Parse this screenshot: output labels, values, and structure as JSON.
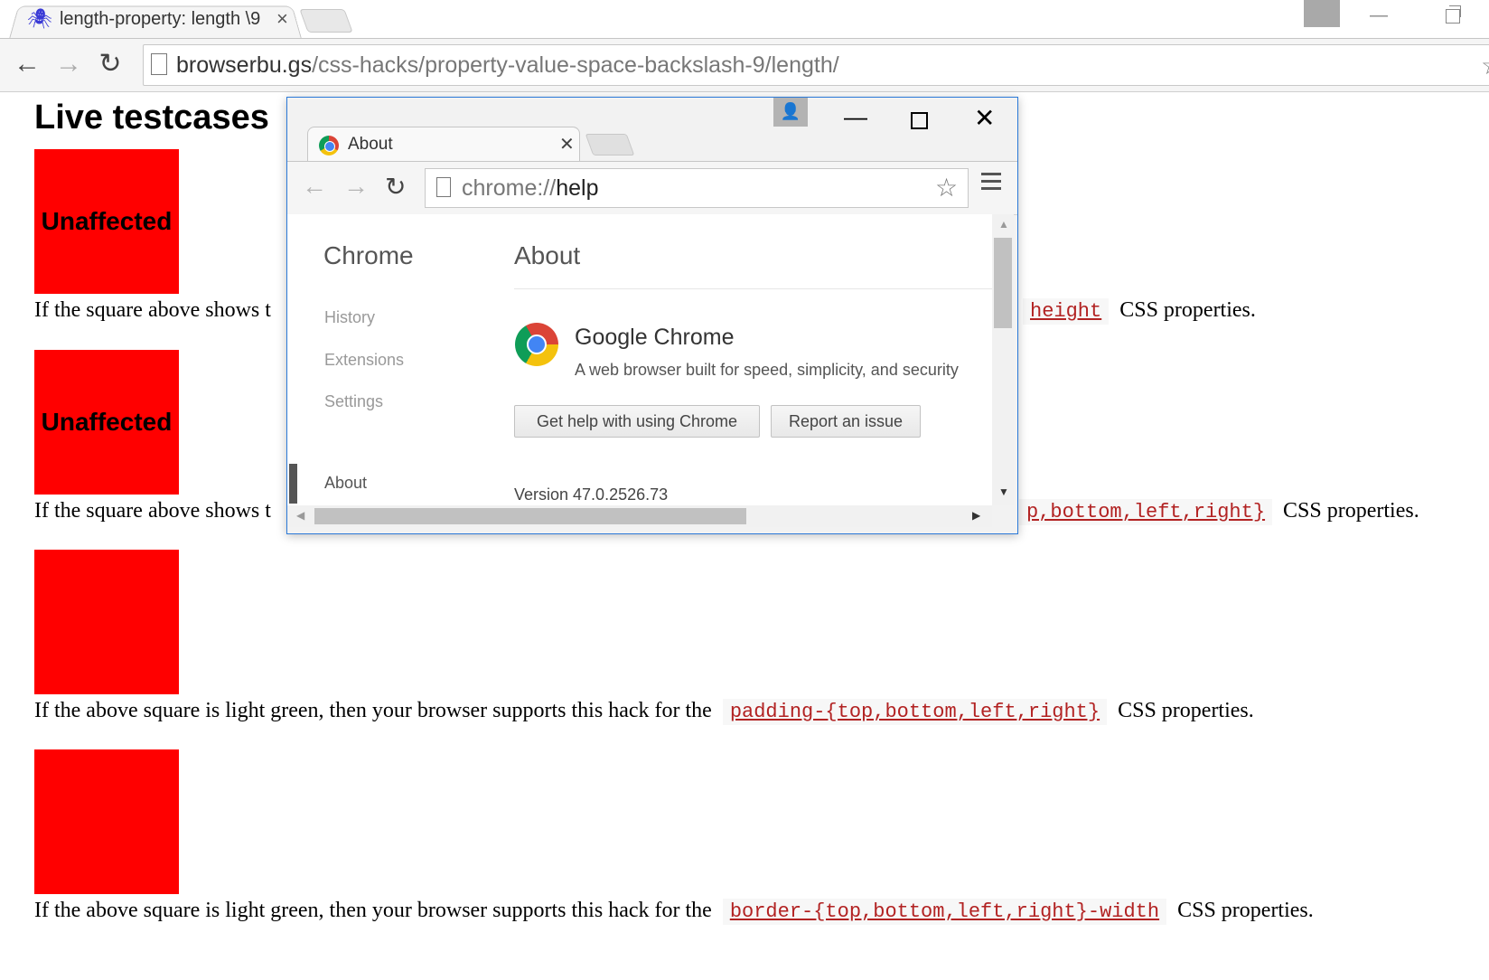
{
  "main_browser": {
    "tab_title": "length-property: length \\9",
    "url_host": "browserbu.gs",
    "url_path": "/css-hacks/property-value-space-backslash-9/length/"
  },
  "page": {
    "title": "Live testcases",
    "testcases": [
      {
        "square_label": "Unaffected",
        "text_visible": "If the square above shows t",
        "code": "height",
        "tail": "CSS properties."
      },
      {
        "square_label": "Unaffected",
        "text_visible": "If the square above shows t",
        "code": "p,bottom,left,right}",
        "tail": "CSS properties."
      },
      {
        "square_label": "",
        "text_visible": "If the above square is light green, then your browser supports this hack for the",
        "code": "padding-{top,bottom,left,right}",
        "tail": "CSS properties."
      },
      {
        "square_label": "",
        "text_visible": "If the above square is light green, then your browser supports this hack for the",
        "code": "border-{top,bottom,left,right}-width",
        "tail": "CSS properties."
      }
    ]
  },
  "popup": {
    "tab_title": "About",
    "url_scheme": "chrome://",
    "url_host": "help",
    "sidebar_title": "Chrome",
    "sidebar_items": [
      "History",
      "Extensions",
      "Settings"
    ],
    "sidebar_active": "About",
    "main_title": "About",
    "product_name": "Google Chrome",
    "tagline": "A web browser built for speed, simplicity, and security",
    "help_button": "Get help with using Chrome",
    "report_button": "Report an issue",
    "version": "Version 47.0.2526.73"
  },
  "colors": {
    "square_fill": "#ff0000",
    "code_text": "#b22222",
    "popup_border": "#2b79d8"
  },
  "icons": [
    "spider-icon",
    "back-arrow-icon",
    "forward-arrow-icon",
    "reload-icon",
    "page-icon",
    "star-icon",
    "profile-icon",
    "menu-icon",
    "chrome-logo-icon"
  ]
}
